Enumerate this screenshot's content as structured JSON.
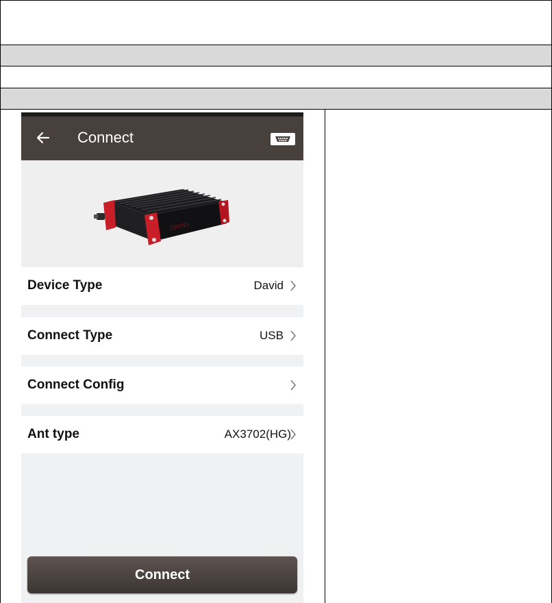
{
  "app": {
    "title": "Connect",
    "icons": {
      "back": "back-arrow-icon",
      "serial": "serial-port-icon",
      "chevron": "chevron-right-icon"
    },
    "device_label": "DAVID"
  },
  "settings": [
    {
      "label": "Device Type",
      "value": "David"
    },
    {
      "label": "Connect Type",
      "value": "USB"
    },
    {
      "label": "Connect Config",
      "value": ""
    },
    {
      "label": "Ant type",
      "value": "AX3702(HG)"
    }
  ],
  "actions": {
    "connect_label": "Connect"
  },
  "colors": {
    "appbar": "#48403c",
    "button": "#4a423e",
    "device_accent": "#c81e28",
    "table_header": "#d9d9d9"
  }
}
